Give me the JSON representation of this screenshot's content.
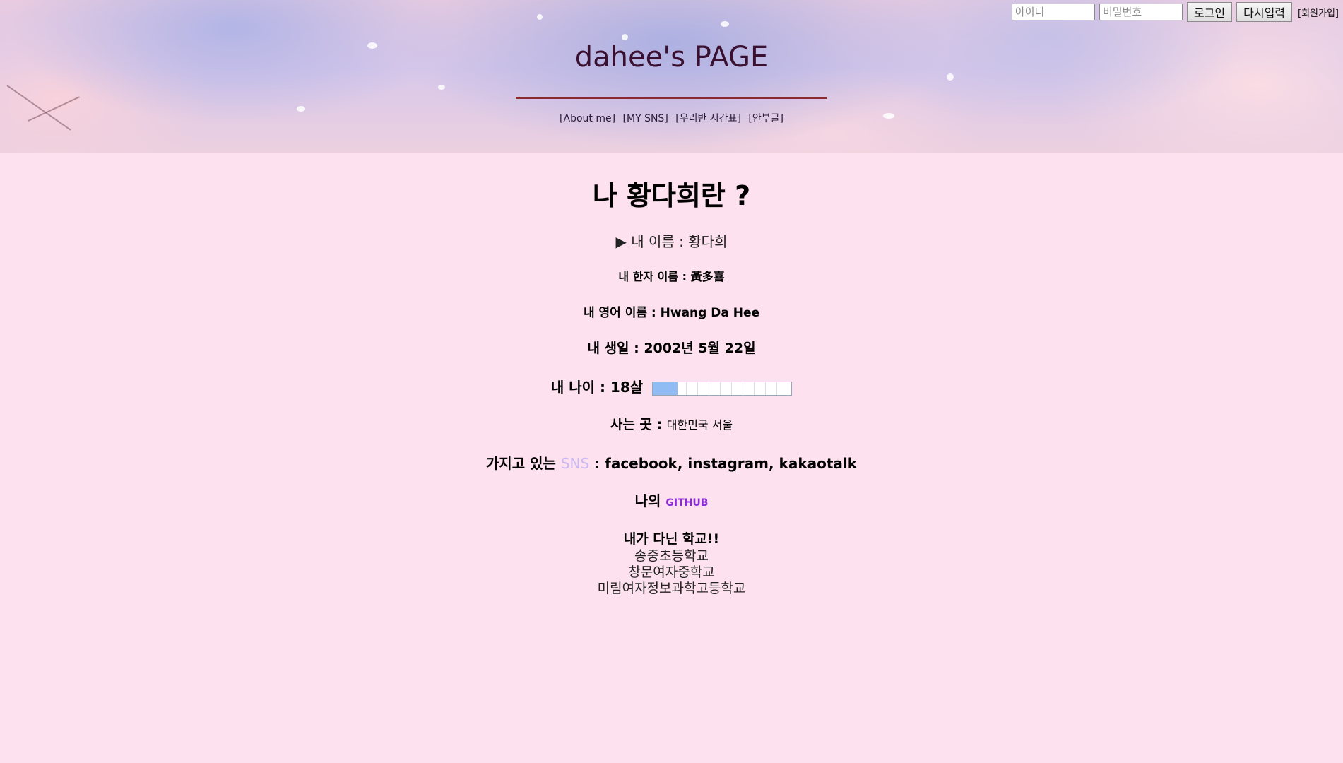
{
  "auth": {
    "id_placeholder": "아이디",
    "pw_placeholder": "비밀번호",
    "login_label": "로그인",
    "reset_label": "다시입력",
    "join_label": "[회원가입]"
  },
  "header": {
    "title": "dahee's PAGE",
    "nav": [
      "[About me]",
      "[MY SNS]",
      "[우리반 시간표]",
      "[안부글]"
    ]
  },
  "profile": {
    "heading": "나 황다희란 ?",
    "name_line": "▶ 내 이름 : 황다희",
    "hanja_line": "내 한자 이름 : 黃多喜",
    "english_line": "내 영어 이름 : Hwang Da Hee",
    "birthday_line": "내 생일 : 2002년 5월 22일",
    "age_label": "내 나이 : 18살",
    "age_meter_fraction": 0.18,
    "home_label": "사는 곳 :",
    "home_value": "대한민국 서울",
    "sns_prefix": "가지고 있는",
    "sns_word": "SNS",
    "sns_suffix": ": facebook, instagram, kakaotalk",
    "github_prefix": "나의",
    "github_link": "GITHUB",
    "schools_heading": "내가 다닌 학교!!",
    "schools": [
      "송중초등학교",
      "창문여자중학교",
      "미림여자정보과학고등학교"
    ]
  },
  "colors": {
    "page_bg": "#fde1ee",
    "title_rule": "#8a2a30",
    "sns_word": "#c9b8f2",
    "github_link": "#8a2ad8",
    "meter_fill": "#8fbcf2"
  }
}
